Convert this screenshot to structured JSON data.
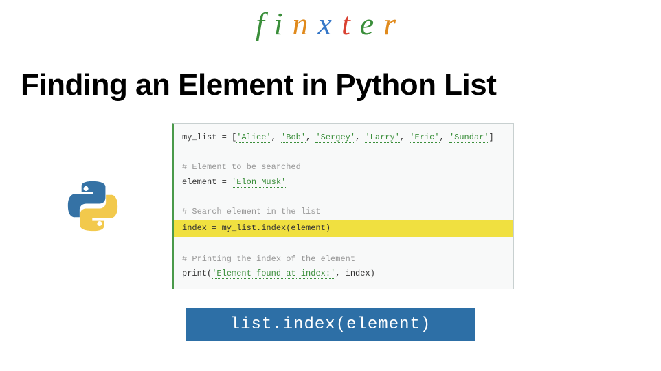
{
  "logo": {
    "chars": [
      "f",
      "i",
      "n",
      "x",
      "t",
      "e",
      "r"
    ]
  },
  "title": "Finding an Element in Python List",
  "code": {
    "line1_pre": "my_list = [",
    "line1_items": [
      "'Alice'",
      "'Bob'",
      "'Sergey'",
      "'Larry'",
      "'Eric'",
      "'Sundar'"
    ],
    "line1_post": "]",
    "comment1": "# Element to be searched",
    "line2_pre": "element = ",
    "line2_str": "'Elon Musk'",
    "comment2": "# Search element in the list",
    "line3": "index = my_list.index(element)",
    "comment3": "# Printing the index of the element",
    "line4_pre": "print(",
    "line4_str": "'Element found at index:'",
    "line4_post": ", index)"
  },
  "method": "list.index(element)"
}
